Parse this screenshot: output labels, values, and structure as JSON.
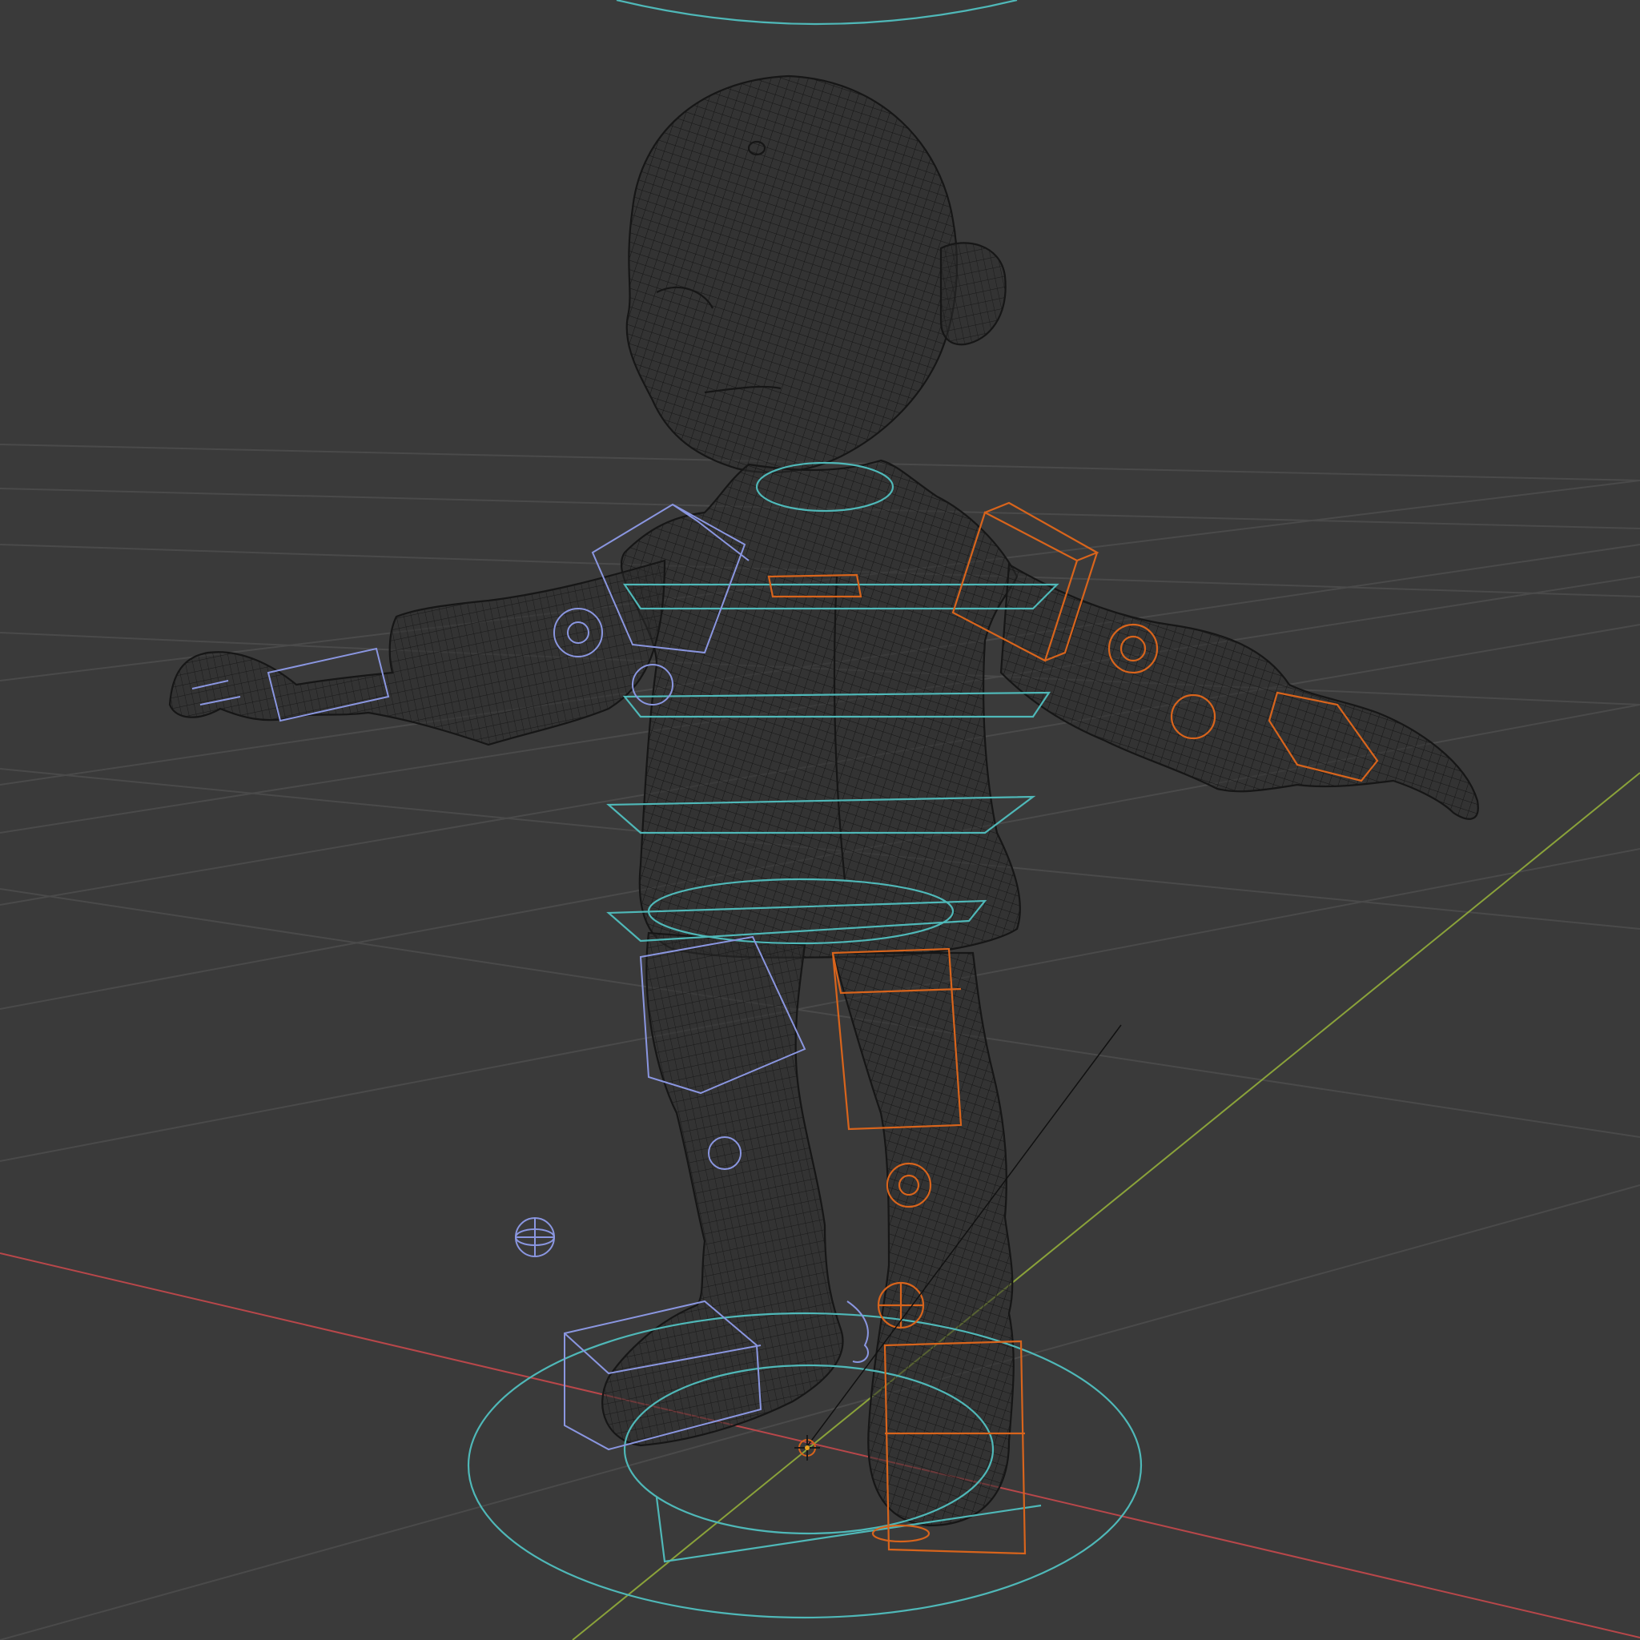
{
  "viewport": {
    "mode": "wireframe",
    "background_color": "#3a3a3a",
    "grid_color": "#4a4a4a",
    "axis_x_color": "#b8474a",
    "axis_y_color": "#8aa23a"
  },
  "scene": {
    "object": "character-mesh",
    "rig_colors": {
      "torso_controls": "#4fb8b8",
      "right_side_controls": "#d8641c",
      "left_side_controls": "#8a96e0"
    },
    "icons": [
      "3d-cursor-icon",
      "object-origin-icon"
    ]
  }
}
